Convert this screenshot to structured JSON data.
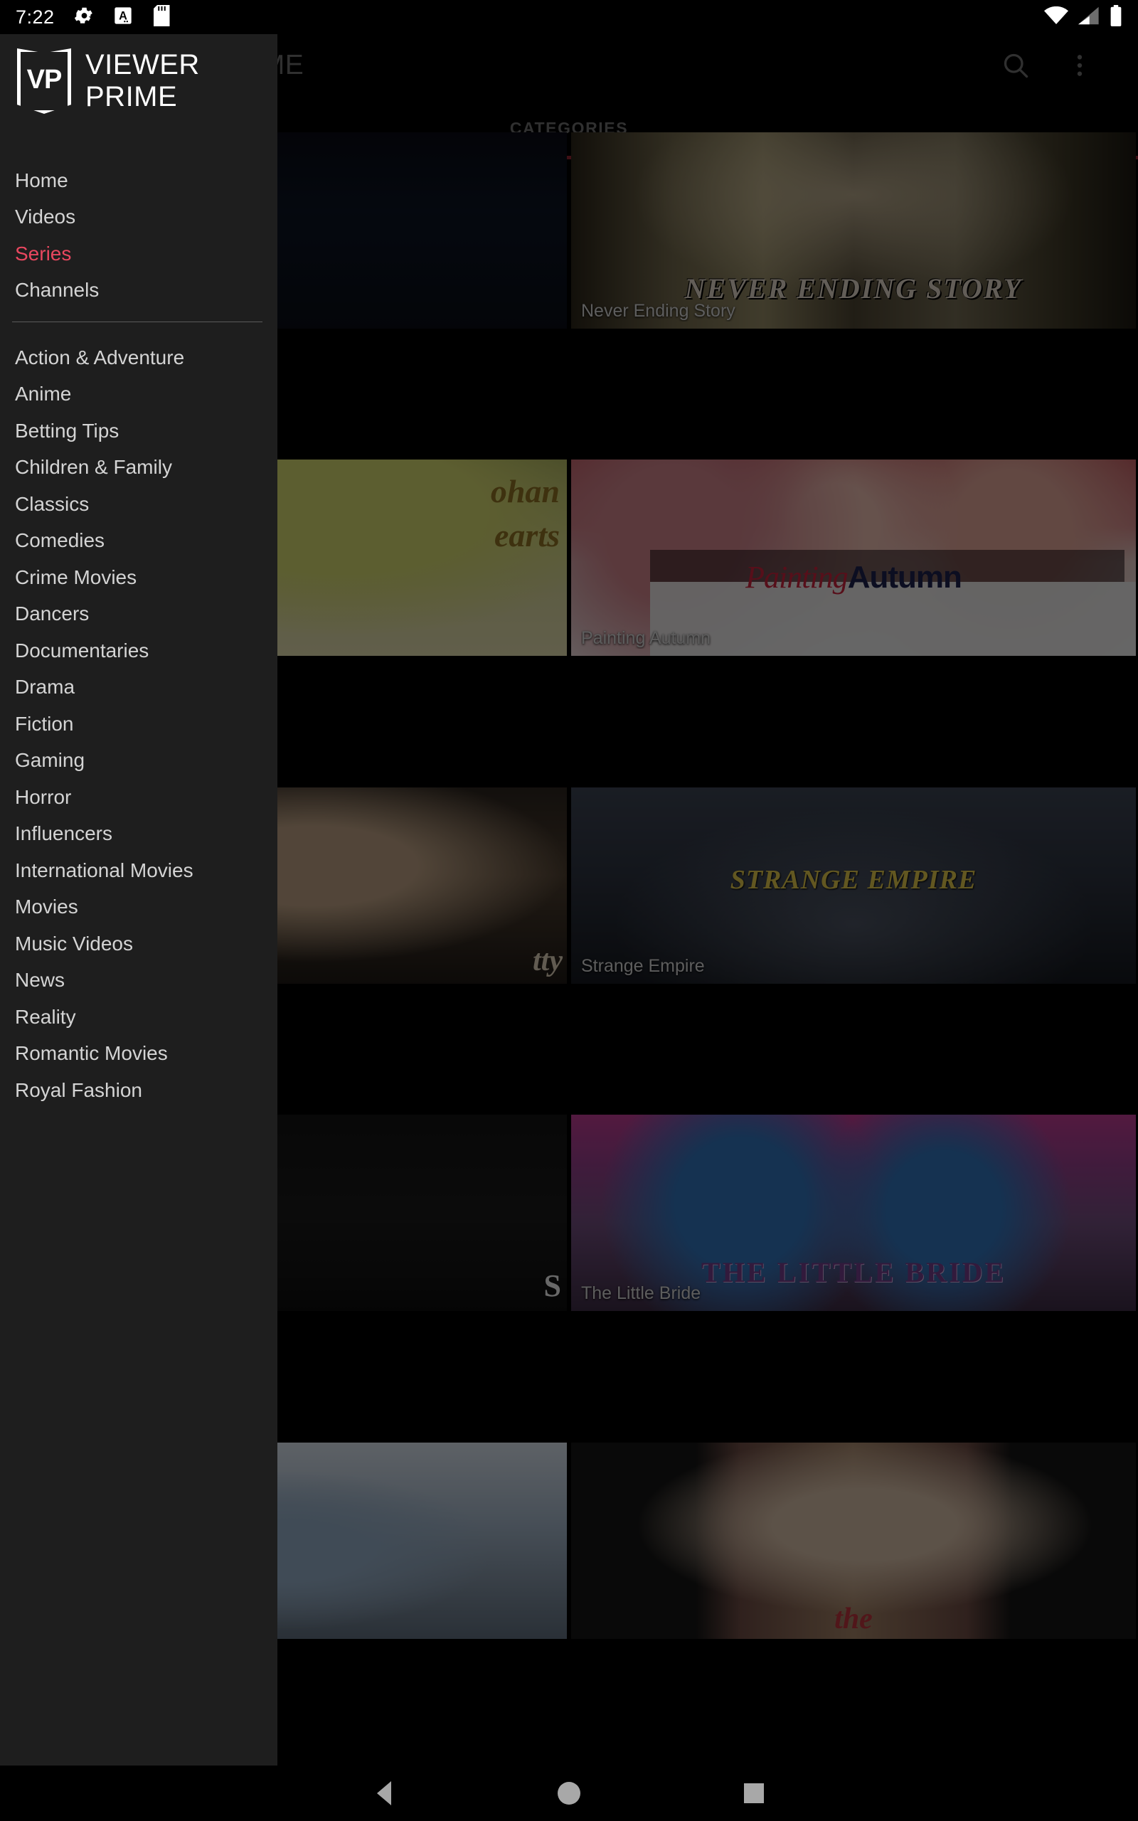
{
  "status_bar": {
    "time": "7:22",
    "left_icons": [
      "gear-icon",
      "a-font-icon",
      "sd-card-icon"
    ],
    "right_icons": [
      "wifi-icon",
      "cellular-signal-icon",
      "battery-icon"
    ]
  },
  "app_bar": {
    "logo_text": "VP",
    "title": "VIEWER PRIME",
    "search_icon": "search-icon",
    "overflow_icon": "more-vertical-icon"
  },
  "tabs": {
    "items": [
      {
        "label": "CATEGORIES",
        "selected": true
      }
    ],
    "indicator_color": "#8c2230"
  },
  "drawer": {
    "logo_text": "VP",
    "title": "VIEWER PRIME",
    "primary_items": [
      {
        "label": "Home",
        "active": false
      },
      {
        "label": "Videos",
        "active": false
      },
      {
        "label": "Series",
        "active": true
      },
      {
        "label": "Channels",
        "active": false
      }
    ],
    "active_color": "#e8475f",
    "categories": [
      "Action & Adventure",
      "Anime",
      "Betting Tips",
      "Children & Family",
      "Classics",
      "Comedies",
      "Crime Movies",
      "Dancers",
      "Documentaries",
      "Drama",
      "Fiction",
      "Gaming",
      "Horror",
      "Influencers",
      "International Movies",
      "Movies",
      "Music Videos",
      "News",
      "Reality",
      "Romantic Movies",
      "Royal Fashion"
    ]
  },
  "content": {
    "cards": [
      {
        "caption": "",
        "art_text": "",
        "art_text2": "",
        "style": "t-left1"
      },
      {
        "caption": "Never Ending Story",
        "art_text": "NEVER ENDING STORY",
        "art_text2": "",
        "style": "t-nes"
      },
      {
        "caption": "",
        "art_text": "ohan",
        "art_text2": "earts",
        "style": "t-left2"
      },
      {
        "caption": "Painting Autumn",
        "art_text": "Painting",
        "art_text2": "Autumn",
        "style": "t-pa"
      },
      {
        "caption": "",
        "art_text": "tty",
        "art_text2": "",
        "style": "t-left3"
      },
      {
        "caption": "Strange Empire",
        "art_text": "STRANGE EMPIRE",
        "art_text2": "",
        "style": "t-se"
      },
      {
        "caption": "",
        "art_text": "S",
        "art_text2": "",
        "style": "t-left4"
      },
      {
        "caption": "The Little Bride",
        "art_text": "THE LITTLE BRIDE",
        "art_text2": "",
        "style": "t-lb"
      },
      {
        "caption": "",
        "art_text": "",
        "art_text2": "",
        "style": "t-left5"
      },
      {
        "caption": "",
        "art_text": "the",
        "art_text2": "",
        "style": "t-tw"
      }
    ]
  },
  "nav_bar": {
    "back_label": "back-button",
    "home_label": "home-button",
    "recents_label": "recents-button"
  }
}
